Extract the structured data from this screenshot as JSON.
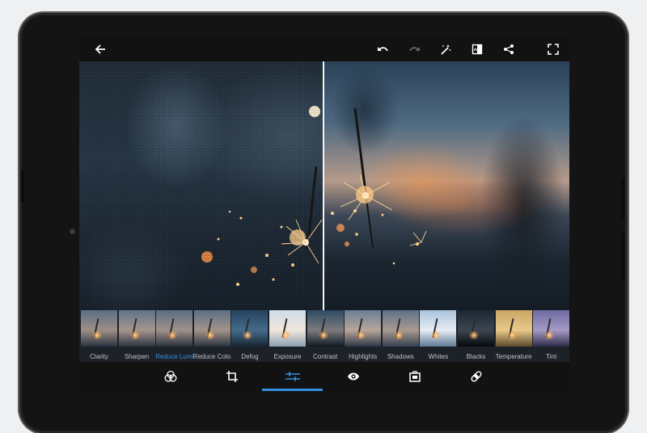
{
  "toolbar": {
    "icons": [
      "back-arrow-icon",
      "undo-icon",
      "redo-icon",
      "magic-wand-icon",
      "compare-icon",
      "share-icon",
      "fullscreen-icon"
    ],
    "redo_enabled": false
  },
  "filmstrip": {
    "active_index": 2,
    "items": [
      {
        "label": "Clarity"
      },
      {
        "label": "Sharpen"
      },
      {
        "label": "Reduce Lumin"
      },
      {
        "label": "Reduce Colo.."
      },
      {
        "label": "Defog"
      },
      {
        "label": "Exposure"
      },
      {
        "label": "Contrast"
      },
      {
        "label": "Highlights"
      },
      {
        "label": "Shadows"
      },
      {
        "label": "Whites"
      },
      {
        "label": "Blacks"
      },
      {
        "label": "Temperature"
      },
      {
        "label": "Tint"
      }
    ]
  },
  "bottom_tabs": {
    "icons": [
      "looks-icon",
      "crop-icon",
      "adjustments-sliders-icon",
      "red-eye-icon",
      "border-icon",
      "healing-icon"
    ],
    "active_index": 2
  },
  "colors": {
    "accent": "#2f8fe0",
    "bar_background": "#121212",
    "icon": "#ffffff"
  }
}
